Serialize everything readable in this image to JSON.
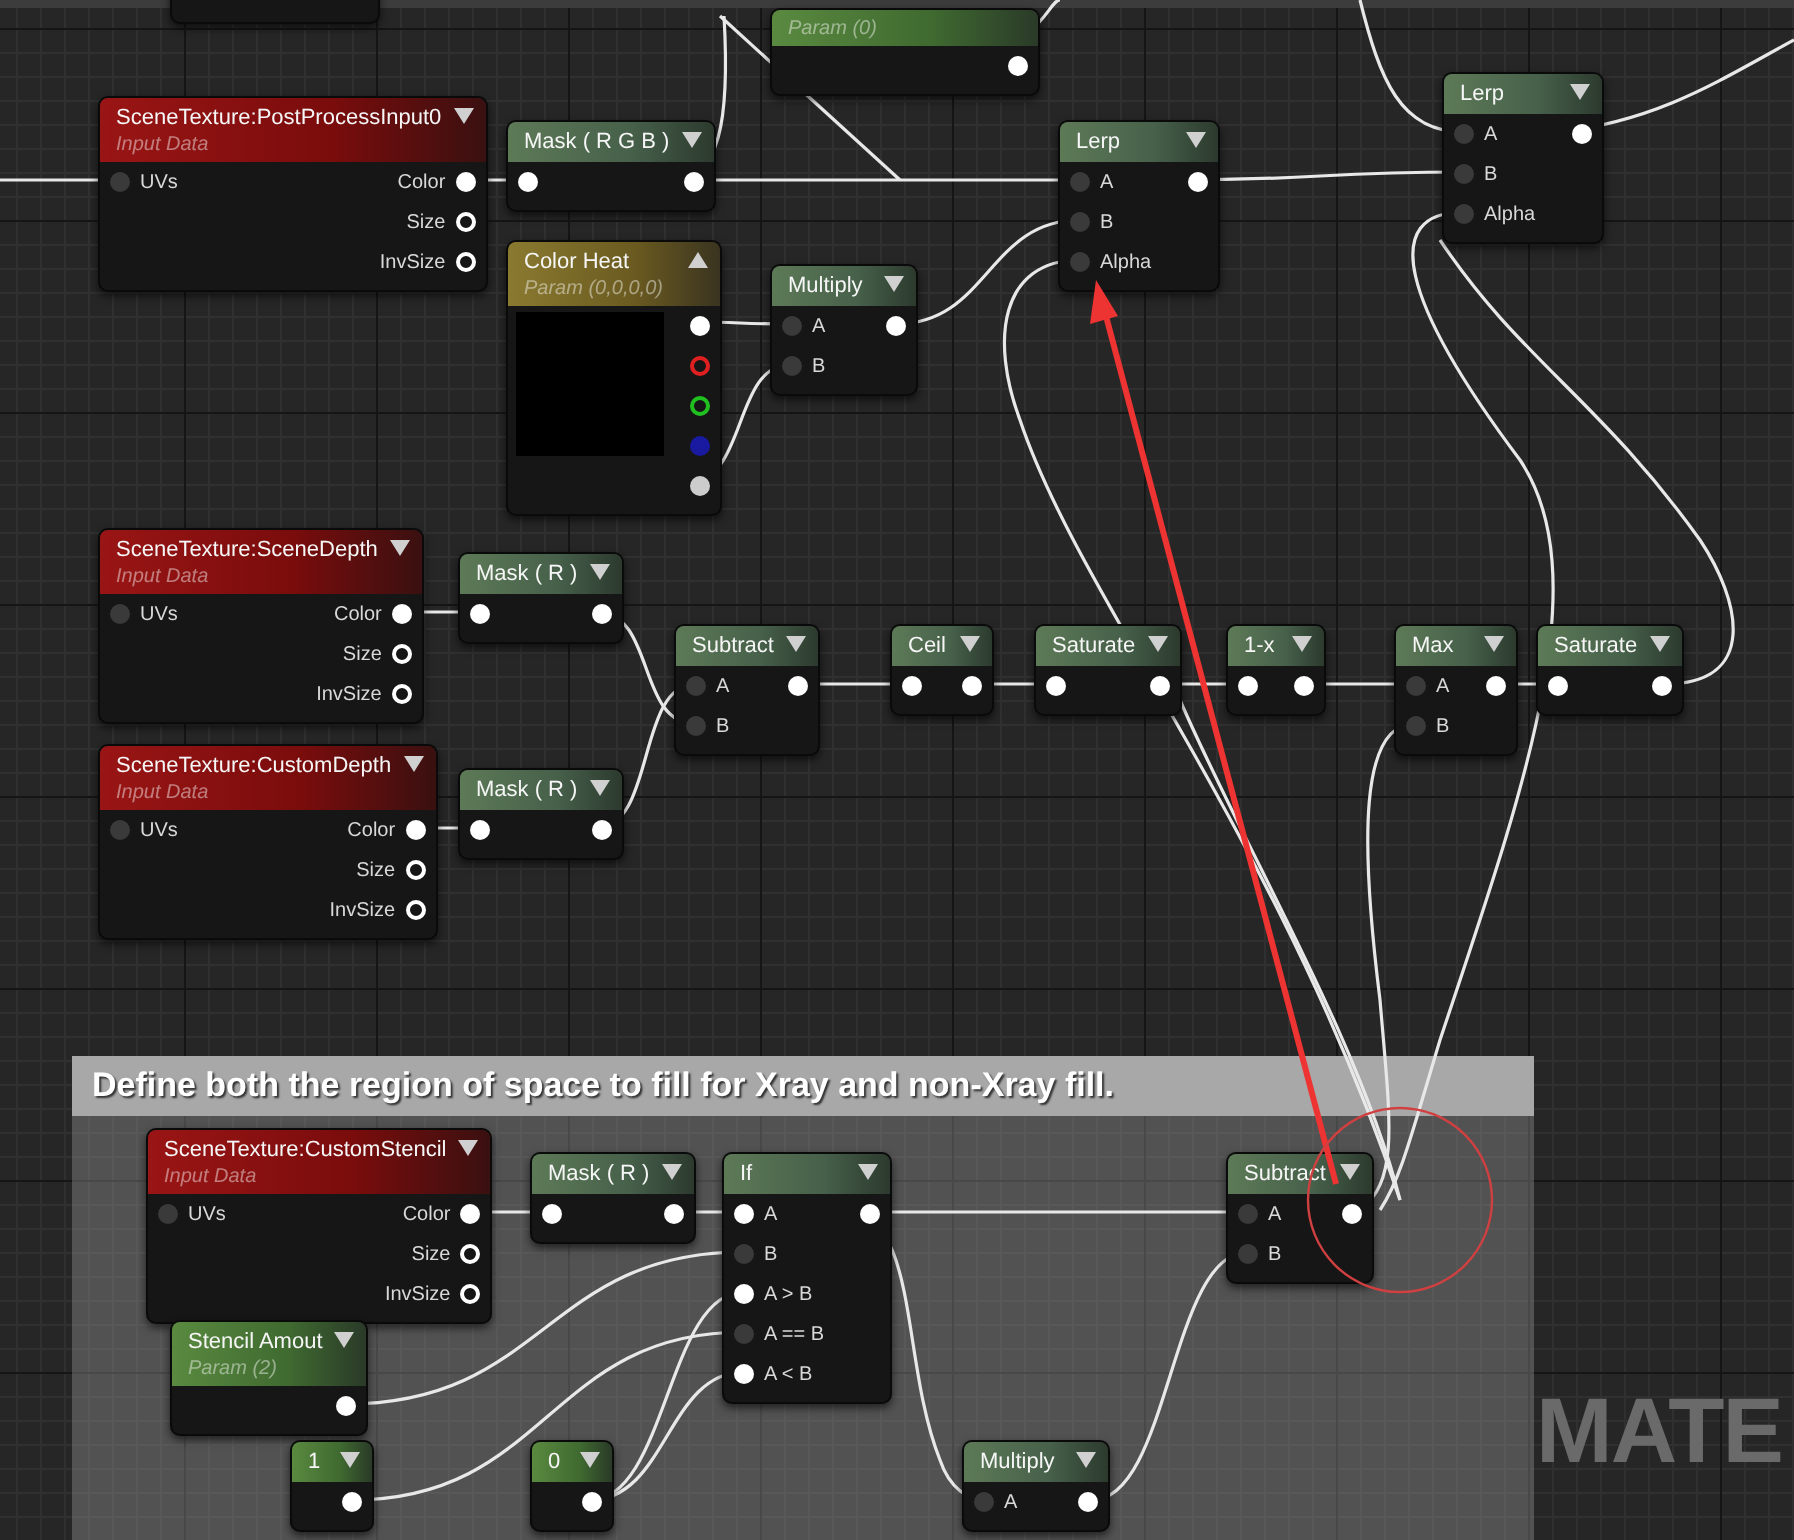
{
  "graph": {
    "background_label": "MATE"
  },
  "comment": {
    "title": "Define both the region of space to fill for Xray and non-Xray fill."
  },
  "nodes": [
    {
      "kind": "fragment"
    },
    {
      "kind": "param",
      "subtitle": "Param (0)",
      "outputs": [
        {
          "filled": true
        }
      ]
    },
    {
      "kind": "texture",
      "title": "SceneTexture:PostProcessInput0",
      "subtitle": "Input Data",
      "inputs": [
        {
          "label": "UVs",
          "filled": false
        }
      ],
      "outputs": [
        {
          "label": "Color",
          "filled": true
        },
        {
          "label": "Size",
          "filled": false
        },
        {
          "label": "InvSize",
          "filled": false
        }
      ]
    },
    {
      "kind": "op",
      "title": "Mask ( R G B )",
      "inputs": [
        {
          "filled": true
        }
      ],
      "outputs": [
        {
          "filled": true
        }
      ]
    },
    {
      "kind": "op",
      "title": "Lerp",
      "inputs": [
        {
          "label": "A",
          "filled": false
        },
        {
          "label": "B",
          "filled": false
        },
        {
          "label": "Alpha",
          "filled": false
        }
      ],
      "outputs": [
        {
          "filled": true
        }
      ]
    },
    {
      "kind": "op",
      "title": "Lerp",
      "inputs": [
        {
          "label": "A",
          "filled": false
        },
        {
          "label": "B",
          "filled": false
        },
        {
          "label": "Alpha",
          "filled": false
        }
      ],
      "outputs": [
        {
          "filled": true
        }
      ]
    },
    {
      "kind": "vector",
      "title": "Color Heat",
      "subtitle": "Param (0,0,0,0)",
      "outputs": [
        {
          "filled": true,
          "color": "#ffffff"
        },
        {
          "filled": false,
          "color": "#e02020"
        },
        {
          "filled": false,
          "color": "#20c020"
        },
        {
          "filled": true,
          "color": "#1a1aa0"
        },
        {
          "filled": true,
          "color": "#cccccc"
        }
      ]
    },
    {
      "kind": "op",
      "title": "Multiply",
      "inputs": [
        {
          "label": "A",
          "filled": false
        },
        {
          "label": "B",
          "filled": false
        }
      ],
      "outputs": [
        {
          "filled": true
        }
      ]
    },
    {
      "kind": "texture",
      "title": "SceneTexture:SceneDepth",
      "subtitle": "Input Data",
      "inputs": [
        {
          "label": "UVs",
          "filled": false
        }
      ],
      "outputs": [
        {
          "label": "Color",
          "filled": true
        },
        {
          "label": "Size",
          "filled": false
        },
        {
          "label": "InvSize",
          "filled": false
        }
      ]
    },
    {
      "kind": "op",
      "title": "Mask ( R )",
      "inputs": [
        {
          "filled": true
        }
      ],
      "outputs": [
        {
          "filled": true
        }
      ]
    },
    {
      "kind": "texture",
      "title": "SceneTexture:CustomDepth",
      "subtitle": "Input Data",
      "inputs": [
        {
          "label": "UVs",
          "filled": false
        }
      ],
      "outputs": [
        {
          "label": "Color",
          "filled": true
        },
        {
          "label": "Size",
          "filled": false
        },
        {
          "label": "InvSize",
          "filled": false
        }
      ]
    },
    {
      "kind": "op",
      "title": "Mask ( R )",
      "inputs": [
        {
          "filled": true
        }
      ],
      "outputs": [
        {
          "filled": true
        }
      ]
    },
    {
      "kind": "op",
      "title": "Subtract",
      "inputs": [
        {
          "label": "A",
          "filled": false
        },
        {
          "label": "B",
          "filled": false
        }
      ],
      "outputs": [
        {
          "filled": true
        }
      ]
    },
    {
      "kind": "op",
      "title": "Ceil",
      "inputs": [
        {
          "filled": true
        }
      ],
      "outputs": [
        {
          "filled": true
        }
      ]
    },
    {
      "kind": "op",
      "title": "Saturate",
      "inputs": [
        {
          "filled": true
        }
      ],
      "outputs": [
        {
          "filled": true
        }
      ]
    },
    {
      "kind": "op",
      "title": "1-x",
      "inputs": [
        {
          "filled": true
        }
      ],
      "outputs": [
        {
          "filled": true
        }
      ]
    },
    {
      "kind": "op",
      "title": "Max",
      "inputs": [
        {
          "label": "A",
          "filled": false
        },
        {
          "label": "B",
          "filled": false
        }
      ],
      "outputs": [
        {
          "filled": true
        }
      ]
    },
    {
      "kind": "op",
      "title": "Saturate",
      "inputs": [
        {
          "filled": true
        }
      ],
      "outputs": [
        {
          "filled": true
        }
      ]
    },
    {
      "kind": "texture",
      "title": "SceneTexture:CustomStencil",
      "subtitle": "Input Data",
      "inputs": [
        {
          "label": "UVs",
          "filled": false
        }
      ],
      "outputs": [
        {
          "label": "Color",
          "filled": true
        },
        {
          "label": "Size",
          "filled": false
        },
        {
          "label": "InvSize",
          "filled": false
        }
      ]
    },
    {
      "kind": "op",
      "title": "Mask ( R )",
      "inputs": [
        {
          "filled": true
        }
      ],
      "outputs": [
        {
          "filled": true
        }
      ]
    },
    {
      "kind": "op",
      "title": "If",
      "inputs": [
        {
          "label": "A",
          "filled": true
        },
        {
          "label": "B",
          "filled": false
        },
        {
          "label": "A > B",
          "filled": true
        },
        {
          "label": "A == B",
          "filled": false
        },
        {
          "label": "A < B",
          "filled": true
        }
      ],
      "outputs": [
        {
          "filled": true
        }
      ]
    },
    {
      "kind": "op",
      "title": "Subtract",
      "inputs": [
        {
          "label": "A",
          "filled": false
        },
        {
          "label": "B",
          "filled": false
        }
      ],
      "outputs": [
        {
          "filled": true
        }
      ]
    },
    {
      "kind": "param",
      "title": "Stencil Amout",
      "subtitle": "Param (2)",
      "outputs": [
        {
          "filled": true
        }
      ]
    },
    {
      "kind": "const",
      "title": "1",
      "outputs": [
        {
          "filled": true
        }
      ]
    },
    {
      "kind": "const",
      "title": "0",
      "outputs": [
        {
          "filled": true
        }
      ]
    },
    {
      "kind": "op",
      "title": "Multiply",
      "inputs": [
        {
          "label": "A",
          "filled": false
        }
      ],
      "outputs": [
        {
          "filled": true
        }
      ]
    }
  ]
}
